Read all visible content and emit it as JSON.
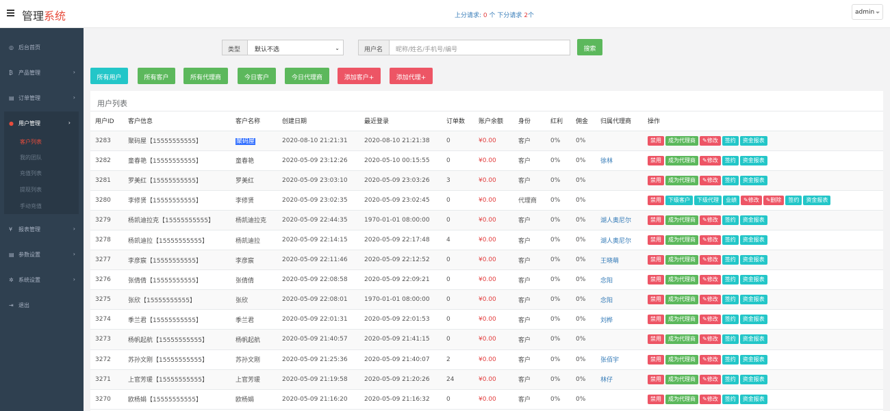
{
  "header": {
    "brand_main": "管理",
    "brand_accent": "系统",
    "req_up_label": "上分请求:",
    "req_up_count": "0",
    "req_up_unit": "个",
    "req_down_label": "下分请求",
    "req_down_count": "2",
    "req_down_unit": "个",
    "user": "admin"
  },
  "sidebar": {
    "items": [
      {
        "icon": "◎",
        "label": "后台首页"
      },
      {
        "icon": "₿",
        "label": "产品管理"
      },
      {
        "icon": "▤",
        "label": "订单管理"
      },
      {
        "icon": "●",
        "label": "用户管理"
      },
      {
        "icon": "¥",
        "label": "报表管理"
      },
      {
        "icon": "▤",
        "label": "参数设置"
      },
      {
        "icon": "✲",
        "label": "系统设置"
      },
      {
        "icon": "⇥",
        "label": "退出"
      }
    ],
    "sub_items": [
      "客户列表",
      "我的团队",
      "充值列表",
      "提现列表",
      "手动充值"
    ],
    "arrow": "›"
  },
  "search": {
    "type_label": "类型",
    "type_value": "默认不选",
    "user_label": "用户名",
    "user_placeholder": "昵称/姓名/手机号/编号",
    "search_button": "搜索"
  },
  "filters": [
    "所有用户",
    "所有客户",
    "所有代理商",
    "今日客户",
    "今日代理商",
    "添加客户+",
    "添加代理+"
  ],
  "table": {
    "title": "用户列表",
    "columns": [
      "用户ID",
      "客户信息",
      "客户名称",
      "创建日期",
      "最近登录",
      "订单数",
      "账户余额",
      "身份",
      "红利",
      "佣金",
      "归属代理商",
      "操作"
    ],
    "rows": [
      {
        "id": "3283",
        "info": "聚码屋【15555555555】",
        "name": "聚码屋",
        "created": "2020-08-10 21:21:31",
        "login": "2020-08-10 21:21:38",
        "orders": "0",
        "balance": "¥0.00",
        "role": "客户",
        "bonus": "0%",
        "commission": "0%",
        "agent": ""
      },
      {
        "id": "3282",
        "info": "童春艳【15555555555】",
        "name": "童春艳",
        "created": "2020-05-09 23:12:26",
        "login": "2020-05-10 00:15:55",
        "orders": "0",
        "balance": "¥0.00",
        "role": "客户",
        "bonus": "0%",
        "commission": "0%",
        "agent": "徐林"
      },
      {
        "id": "3281",
        "info": "罗美红【15555555555】",
        "name": "罗美红",
        "created": "2020-05-09 23:03:10",
        "login": "2020-05-09 23:03:26",
        "orders": "3",
        "balance": "¥0.00",
        "role": "客户",
        "bonus": "0%",
        "commission": "0%",
        "agent": ""
      },
      {
        "id": "3280",
        "info": "李修贤【15555555555】",
        "name": "李修贤",
        "created": "2020-05-09 23:02:35",
        "login": "2020-05-09 23:02:45",
        "orders": "0",
        "balance": "¥0.00",
        "role": "代理商",
        "bonus": "0%",
        "commission": "0%",
        "agent": ""
      },
      {
        "id": "3279",
        "info": "杨凯迪拉克【15555555555】",
        "name": "杨凯迪拉克",
        "created": "2020-05-09 22:44:35",
        "login": "1970-01-01 08:00:00",
        "orders": "0",
        "balance": "¥0.00",
        "role": "客户",
        "bonus": "0%",
        "commission": "0%",
        "agent": "湖人奥尼尔"
      },
      {
        "id": "3278",
        "info": "杨凯迪拉【15555555555】",
        "name": "杨凯迪拉",
        "created": "2020-05-09 22:14:15",
        "login": "2020-05-09 22:17:48",
        "orders": "4",
        "balance": "¥0.00",
        "role": "客户",
        "bonus": "0%",
        "commission": "0%",
        "agent": "湖人奥尼尔"
      },
      {
        "id": "3277",
        "info": "李彦宸【15555555555】",
        "name": "李彦宸",
        "created": "2020-05-09 22:11:46",
        "login": "2020-05-09 22:12:52",
        "orders": "0",
        "balance": "¥0.00",
        "role": "客户",
        "bonus": "0%",
        "commission": "0%",
        "agent": "王晓萌"
      },
      {
        "id": "3276",
        "info": "张倩倩【15555555555】",
        "name": "张倩倩",
        "created": "2020-05-09 22:08:58",
        "login": "2020-05-09 22:09:21",
        "orders": "0",
        "balance": "¥0.00",
        "role": "客户",
        "bonus": "0%",
        "commission": "0%",
        "agent": "念阳"
      },
      {
        "id": "3275",
        "info": "张欣【15555555555】",
        "name": "张欣",
        "created": "2020-05-09 22:08:01",
        "login": "1970-01-01 08:00:00",
        "orders": "0",
        "balance": "¥0.00",
        "role": "客户",
        "bonus": "0%",
        "commission": "0%",
        "agent": "念阳"
      },
      {
        "id": "3274",
        "info": "季兰君【15555555555】",
        "name": "季兰君",
        "created": "2020-05-09 22:01:31",
        "login": "2020-05-09 22:01:53",
        "orders": "0",
        "balance": "¥0.00",
        "role": "客户",
        "bonus": "0%",
        "commission": "0%",
        "agent": "刘桦"
      },
      {
        "id": "3273",
        "info": "杨帆起航【15555555555】",
        "name": "杨帆起航",
        "created": "2020-05-09 21:40:57",
        "login": "2020-05-09 21:41:15",
        "orders": "0",
        "balance": "¥0.00",
        "role": "客户",
        "bonus": "0%",
        "commission": "0%",
        "agent": ""
      },
      {
        "id": "3272",
        "info": "苏孙文刚【15555555555】",
        "name": "苏孙文刚",
        "created": "2020-05-09 21:25:36",
        "login": "2020-05-09 21:40:07",
        "orders": "2",
        "balance": "¥0.00",
        "role": "客户",
        "bonus": "0%",
        "commission": "0%",
        "agent": "张佰宇"
      },
      {
        "id": "3271",
        "info": "上官芳瑗【15555555555】",
        "name": "上官芳瑗",
        "created": "2020-05-09 21:19:58",
        "login": "2020-05-09 21:20:26",
        "orders": "24",
        "balance": "¥0.00",
        "role": "客户",
        "bonus": "0%",
        "commission": "0%",
        "agent": "林仔"
      },
      {
        "id": "3270",
        "info": "欧杨娟【15555555555】",
        "name": "欧杨娟",
        "created": "2020-05-09 21:16:20",
        "login": "2020-05-09 21:16:32",
        "orders": "0",
        "balance": "¥0.00",
        "role": "客户",
        "bonus": "0%",
        "commission": "0%",
        "agent": ""
      }
    ],
    "client_actions": [
      "禁用",
      "成为代理商",
      "✎修改",
      "签约",
      "资金报表"
    ],
    "agent_actions": [
      "禁用",
      "下级客户",
      "下级代理",
      "业绩",
      "✎修改",
      "✎删除",
      "签约",
      "资金报表"
    ]
  },
  "colors": {
    "sidebar_bg": "#2f4050",
    "accent_red": "#e74c3c",
    "teal": "#23c6c8",
    "green": "#5cb85c",
    "danger": "#ed5565"
  }
}
